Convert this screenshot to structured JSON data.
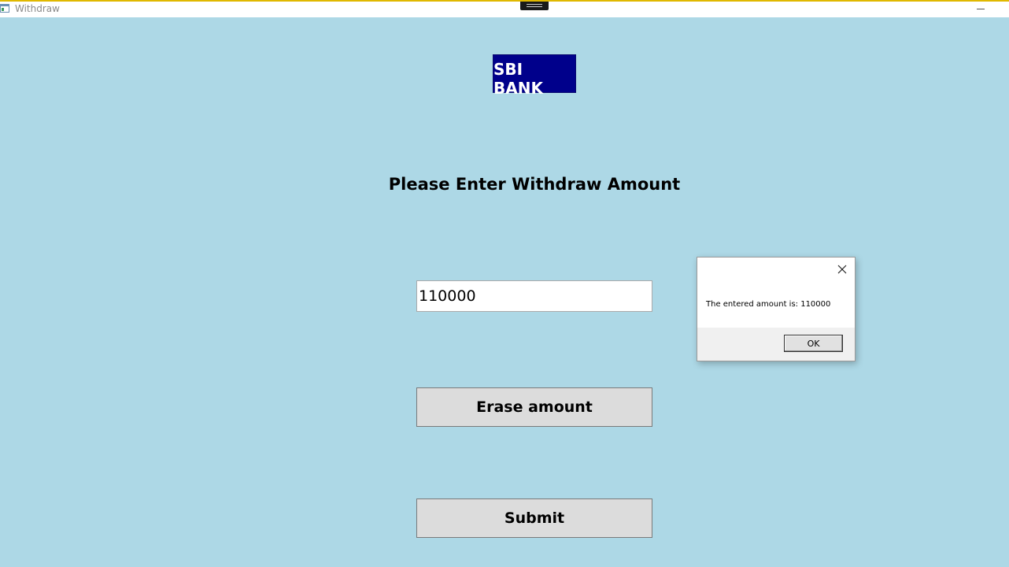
{
  "window": {
    "title": "Withdraw",
    "background_color": "#ADD8E6"
  },
  "logo": {
    "text": "SBI BANK",
    "background_color": "#00008B",
    "text_color": "#FFFFFF"
  },
  "form": {
    "heading": "Please Enter Withdraw Amount",
    "amount_value": "110000",
    "erase_label": "Erase amount",
    "submit_label": "Submit"
  },
  "message_box": {
    "text": "The entered amount is: 110000",
    "ok_label": "OK",
    "close_icon": "close-icon"
  },
  "icons": {
    "app": "app-window-icon",
    "minimize": "minimize-icon",
    "snap": "snap-handle-icon"
  }
}
